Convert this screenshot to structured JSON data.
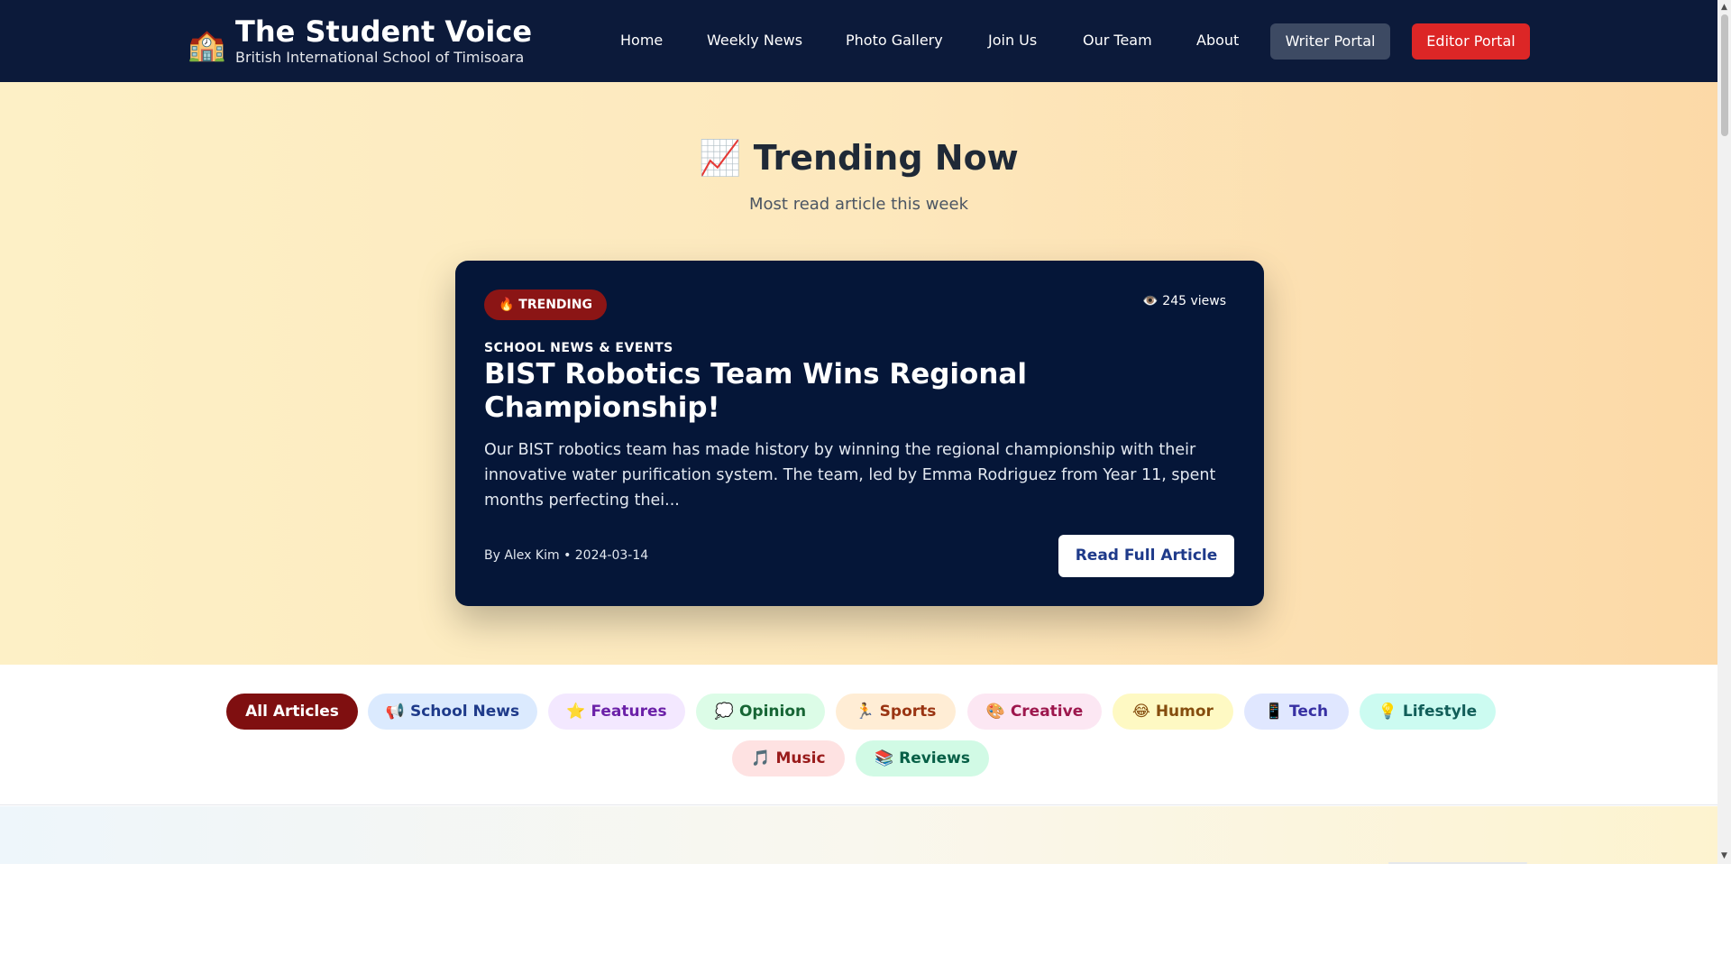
{
  "header": {
    "logo_icon": "🏫",
    "title": "The Student Voice",
    "subtitle": "British International School of Timisoara",
    "nav": [
      "Home",
      "Weekly News",
      "Photo Gallery",
      "Join Us",
      "Our Team",
      "About"
    ],
    "writer_portal": "Writer Portal",
    "editor_portal": "Editor Portal"
  },
  "trending": {
    "title": "📈 Trending Now",
    "subtitle": "Most read article this week",
    "badge": "🔥 TRENDING",
    "views": "👁️ 245 views",
    "category": "SCHOOL NEWS & EVENTS",
    "article_title": "BIST Robotics Team Wins Regional Championship!",
    "excerpt": "Our BIST robotics team has made history by winning the regional championship with their innovative water purification system. The team, led by Emma Rodriguez from Year 11, spent months perfecting thei...",
    "meta": "By Alex Kim • 2024-03-14",
    "read_button": "Read Full Article"
  },
  "filters": [
    {
      "label": "All Articles",
      "bg": "#7f0f10",
      "fg": "#ffffff",
      "active": true
    },
    {
      "label": "📢 School News",
      "bg": "#dbeafe",
      "fg": "#1e3a8a"
    },
    {
      "label": "⭐ Features",
      "bg": "#f3e8ff",
      "fg": "#6b21a8"
    },
    {
      "label": "💭 Opinion",
      "bg": "#dcfce7",
      "fg": "#166534"
    },
    {
      "label": "🏃 Sports",
      "bg": "#ffedd5",
      "fg": "#9a3412"
    },
    {
      "label": "🎨 Creative",
      "bg": "#fce7f3",
      "fg": "#9d174d"
    },
    {
      "label": "😂 Humor",
      "bg": "#fef9c3",
      "fg": "#854d0e"
    },
    {
      "label": "📱 Tech",
      "bg": "#e0e7ff",
      "fg": "#3730a3"
    },
    {
      "label": "💡 Lifestyle",
      "bg": "#ccfbf1",
      "fg": "#115e59"
    },
    {
      "label": "🎵 Music",
      "bg": "#fee2e2",
      "fg": "#991b1b"
    },
    {
      "label": "📚 Reviews",
      "bg": "#d1fae5",
      "fg": "#065f46"
    }
  ],
  "scrollbar": {
    "up_icon": "▲",
    "down_icon": "▼"
  }
}
